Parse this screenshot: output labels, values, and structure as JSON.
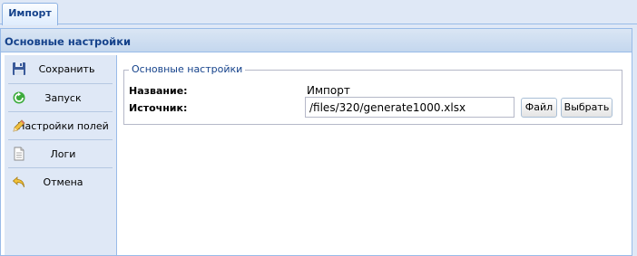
{
  "tabs": [
    {
      "label": "Импорт",
      "active": true
    }
  ],
  "window": {
    "title": "Основные настройки"
  },
  "toolbar": {
    "items": [
      {
        "label": "Сохранить",
        "icon": "floppy-disk-icon"
      },
      {
        "label": "Запуск",
        "icon": "run-arrow-icon"
      },
      {
        "label": "Настройки полей",
        "icon": "pencil-icon"
      },
      {
        "label": "Логи",
        "icon": "document-icon"
      },
      {
        "label": "Отмена",
        "icon": "undo-arrow-icon"
      }
    ]
  },
  "form": {
    "legend": "Основные настройки",
    "name_label": "Название:",
    "name_value": "Импорт",
    "source_label": "Источник:",
    "source_value": "/files/320/generate1000.xlsx",
    "file_button": "Файл",
    "choose_button": "Выбрать"
  },
  "colors": {
    "header_text": "#15428b",
    "border": "#99bbe8",
    "panel_bg": "#dfe8f6"
  }
}
